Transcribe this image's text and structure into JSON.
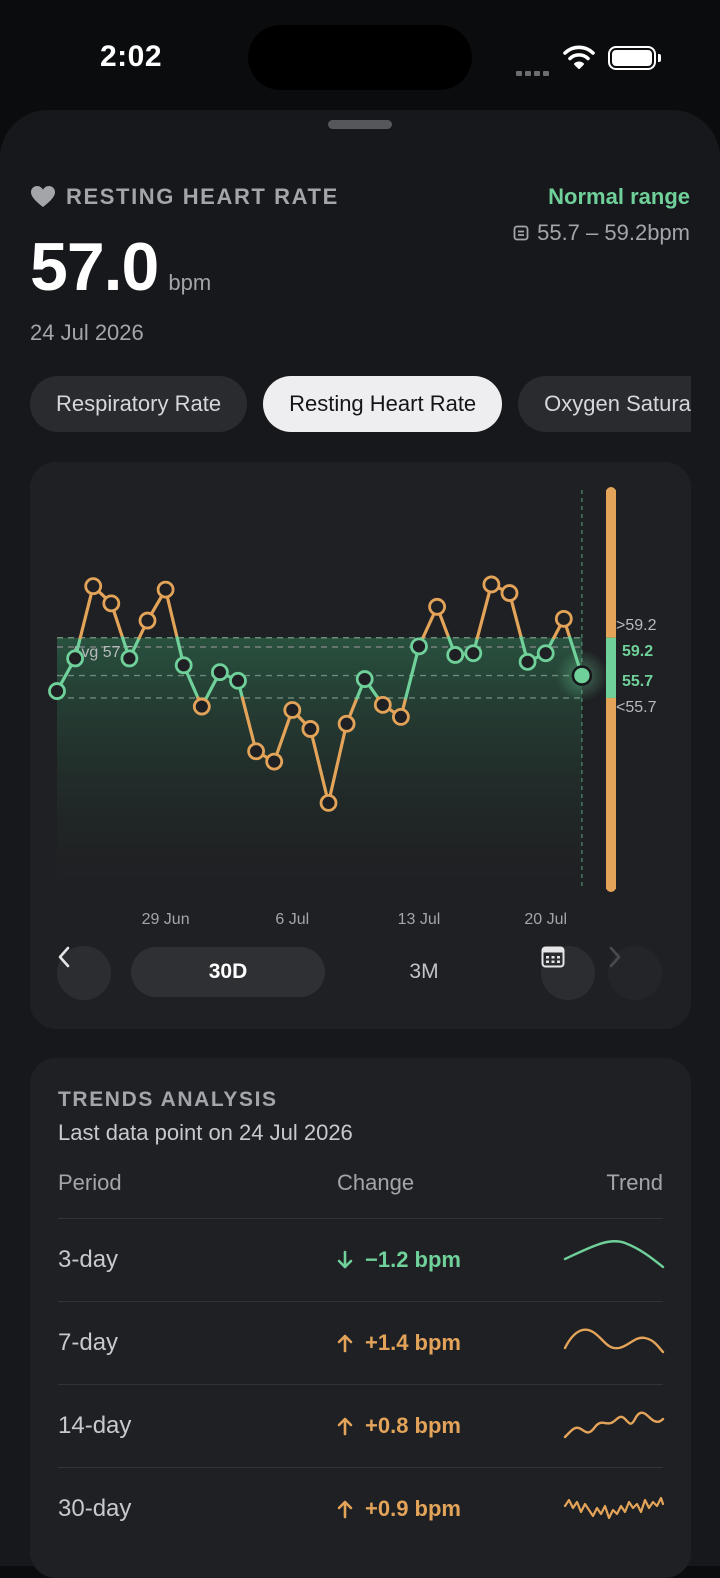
{
  "status_bar": {
    "time": "2:02"
  },
  "metric": {
    "icon": "heart-icon",
    "label": "RESTING HEART RATE",
    "value": "57.0",
    "unit": "bpm",
    "date": "24 Jul 2026",
    "range_title": "Normal range",
    "range_values": "55.7 – 59.2bpm"
  },
  "tabs": [
    {
      "label": "Respiratory Rate",
      "active": false
    },
    {
      "label": "Resting Heart Rate",
      "active": true
    },
    {
      "label": "Oxygen Saturation",
      "active": false
    }
  ],
  "chart_data": {
    "type": "line",
    "y": [
      56.1,
      58.0,
      62.2,
      61.2,
      58.0,
      60.2,
      62.0,
      57.6,
      55.2,
      57.2,
      56.7,
      52.6,
      52.0,
      55.0,
      53.9,
      49.6,
      54.2,
      56.8,
      55.3,
      54.6,
      58.7,
      61.0,
      58.2,
      58.3,
      62.3,
      61.8,
      57.8,
      58.3,
      60.3,
      57.0
    ],
    "x_ticks": [
      "29 Jun",
      "6 Jul",
      "13 Jul",
      "20 Jul"
    ],
    "normal_range": [
      55.7,
      59.2
    ],
    "range_labels": {
      "above": ">59.2",
      "top": "59.2",
      "bottom": "55.7",
      "below": "<55.7"
    },
    "average_label": "Avg 57.5",
    "colors": {
      "in_range": "#6fd09a",
      "out_of_range": "#e3a45a"
    },
    "grid": false,
    "last_point_highlighted": true
  },
  "chart_controls": {
    "prev_icon": "chevron-left-icon",
    "next_icon": "chevron-right-icon",
    "calendar_icon": "calendar-icon",
    "periods": [
      {
        "label": "30D",
        "active": true
      },
      {
        "label": "3M",
        "active": false
      }
    ]
  },
  "trends": {
    "title": "TRENDS ANALYSIS",
    "subtitle": "Last data point on 24 Jul 2026",
    "headers": {
      "period": "Period",
      "change": "Change",
      "trend": "Trend"
    },
    "rows": [
      {
        "period": "3-day",
        "change": "−1.2 bpm",
        "direction": "down",
        "color": "#6fd09a"
      },
      {
        "period": "7-day",
        "change": "+1.4 bpm",
        "direction": "up",
        "color": "#e3a45a"
      },
      {
        "period": "14-day",
        "change": "+0.8 bpm",
        "direction": "up",
        "color": "#e3a45a"
      },
      {
        "period": "30-day",
        "change": "+0.9 bpm",
        "direction": "up",
        "color": "#e3a45a"
      }
    ]
  }
}
